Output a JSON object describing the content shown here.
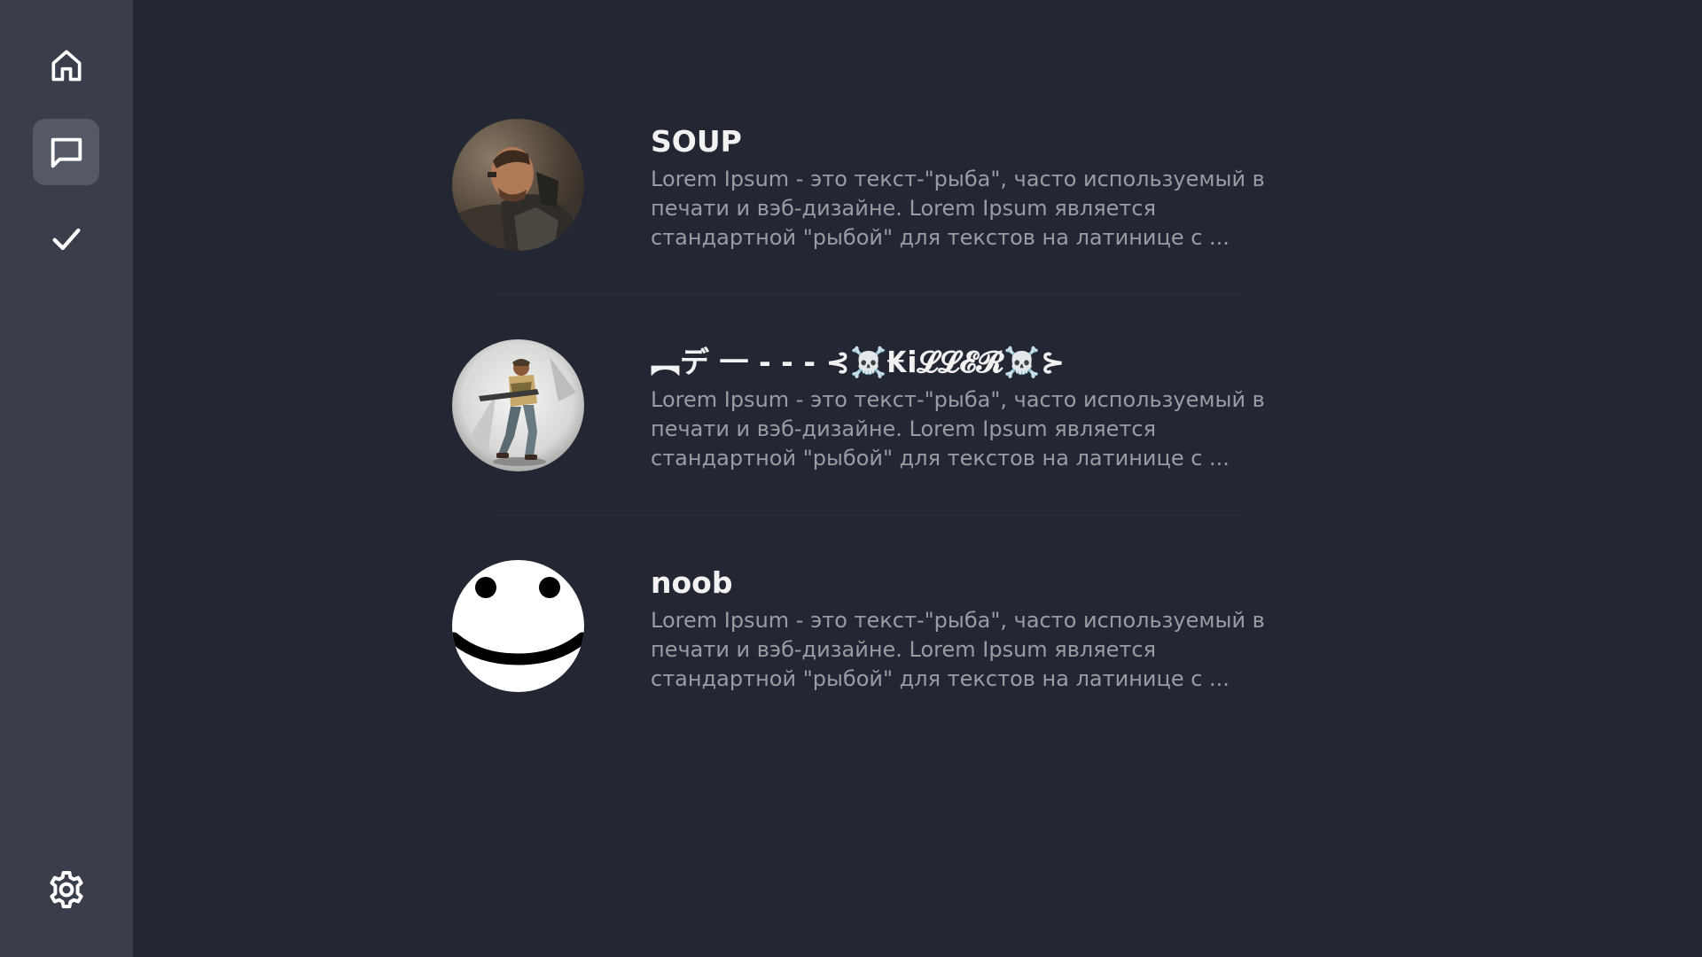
{
  "sidebar": {
    "items": [
      {
        "name": "home",
        "icon": "home-icon",
        "active": false
      },
      {
        "name": "chats",
        "icon": "chat-bubble-icon",
        "active": true
      },
      {
        "name": "tasks",
        "icon": "checkmark-icon",
        "active": false
      }
    ],
    "bottom": {
      "name": "settings",
      "icon": "gear-icon"
    }
  },
  "chats": [
    {
      "name": "SOUP",
      "avatar_icon": "soldier-portrait-avatar",
      "preview_lines": [
        "Lorem Ipsum - это текст-\"рыба\", часто используемый в",
        "печати и вэб-дизайне. Lorem Ipsum является",
        "стандартной \"рыбой\" для текстов на латинице с ..."
      ]
    },
    {
      "name": "︻デ 一 - - - ⊰☠️₭i𝓛𝓛𝓔𝓡☠️⊱",
      "avatar_icon": "running-soldier-avatar",
      "preview_lines": [
        "Lorem Ipsum - это текст-\"рыба\", часто используемый в",
        "печати и вэб-дизайне. Lorem Ipsum является",
        "стандартной \"рыбой\" для текстов на латинице с ..."
      ]
    },
    {
      "name": "noob",
      "avatar_icon": "smiley-face-avatar",
      "preview_lines": [
        "Lorem Ipsum - это текст-\"рыба\", часто используемый в",
        "печати и вэб-дизайне. Lorem Ipsum является",
        "стандартной \"рыбой\" для текстов на латинице с ..."
      ]
    }
  ],
  "colors": {
    "background": "#222733",
    "sidebar": "#3a3e4a",
    "active_nav": "#555965",
    "name_text": "#f2f2f2",
    "preview_text": "#9a9ca3"
  }
}
